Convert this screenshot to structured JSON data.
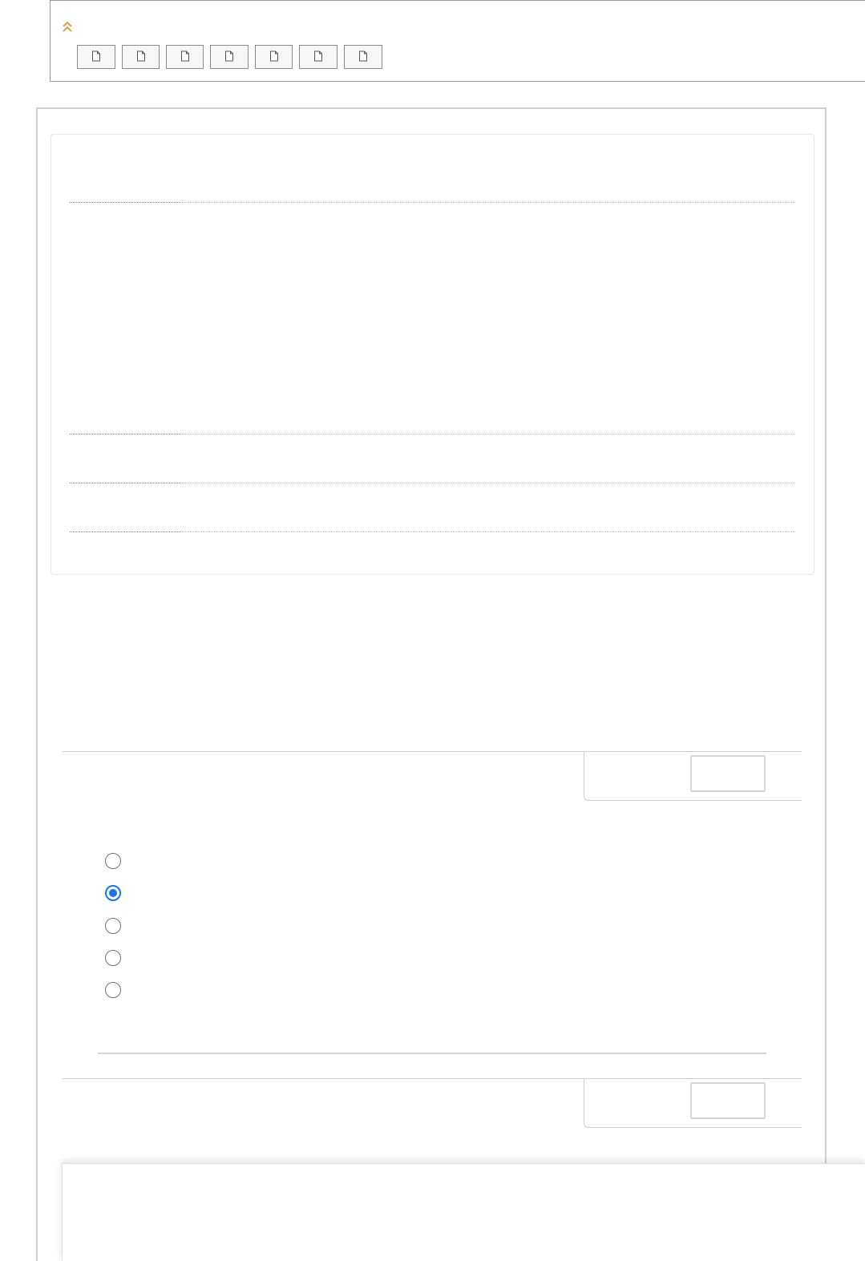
{
  "toolbar": {
    "collapse_icon": "double-chevron-up-icon",
    "accent_color": "#d4a04a",
    "document_buttons": [
      {
        "icon": "document-icon"
      },
      {
        "icon": "document-icon"
      },
      {
        "icon": "document-icon"
      },
      {
        "icon": "document-icon"
      },
      {
        "icon": "document-icon"
      },
      {
        "icon": "document-icon"
      },
      {
        "icon": "document-icon"
      }
    ]
  },
  "questions": [
    {
      "score_value": "",
      "options": [
        {
          "selected": false
        },
        {
          "selected": true
        },
        {
          "selected": false
        },
        {
          "selected": false
        },
        {
          "selected": false
        }
      ]
    },
    {
      "score_value": ""
    }
  ],
  "colors": {
    "selected_radio": "#1a73e8",
    "border": "#cfcfcf"
  }
}
